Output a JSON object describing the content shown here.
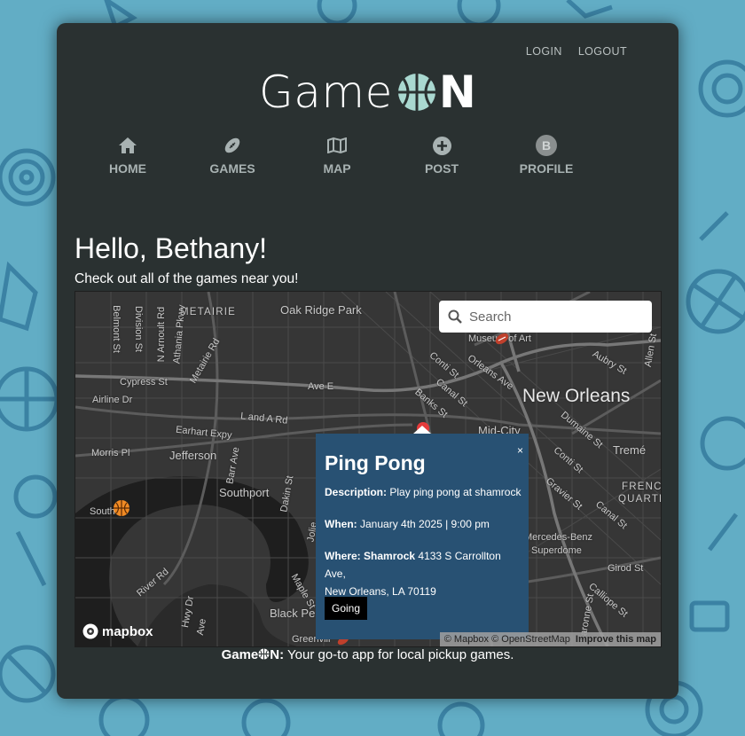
{
  "header": {
    "login_label": "LOGIN",
    "logout_label": "LOGOUT",
    "logo_left": "Game",
    "logo_right": "N"
  },
  "nav": [
    {
      "label": "HOME",
      "icon": "home-icon"
    },
    {
      "label": "GAMES",
      "icon": "football-icon"
    },
    {
      "label": "MAP",
      "icon": "map-icon"
    },
    {
      "label": "POST",
      "icon": "plus-circle-icon"
    },
    {
      "label": "PROFILE",
      "icon": "avatar-b-icon",
      "avatar_letter": "B"
    }
  ],
  "main": {
    "greeting": "Hello, Bethany!",
    "subtitle": "Check out all of the games near you!"
  },
  "map": {
    "search_placeholder": "Search",
    "labels": {
      "metairie": "METAIRIE",
      "oak_ridge_park": "Oak Ridge Park",
      "museum_of_art": "Museum of Art",
      "new_orleans": "New Orleans",
      "mid_city": "Mid-City",
      "treme": "Tremé",
      "french_quarter_a": "FRENCH",
      "french_quarter_b": "QUARTE",
      "jefferson": "Jefferson",
      "southport": "Southport",
      "black_pearl": "Black Pe",
      "greenville": "Greenvill",
      "mercedes_a": "Mercedes-Benz",
      "mercedes_b": "Superdome",
      "airline_dr": "Airline Dr",
      "earhart": "Earhart Expy",
      "cypress": "Cypress St",
      "l_and_a": "L and A Rd",
      "ave_e": "Ave E",
      "conti": "Conti St",
      "orleans_ave": "Orleans Ave",
      "canal": "Canal St",
      "banks": "Banks St",
      "aubry": "Aubry St",
      "allen": "Allen St",
      "dumaine": "Dumaine St",
      "gravier": "Gravier St",
      "girod": "Girod St",
      "calliope": "Calliope St",
      "river_rd": "River Rd",
      "morris": "Morris Pl",
      "south_p": "South P",
      "belmont": "Belmont St",
      "division": "Division St",
      "n_arnoult": "N Arnoult Rd",
      "athania": "Athania Pkwy",
      "metairie_rd": "Metairie Rd",
      "dakin": "Dakin St",
      "maple": "Maple St",
      "jolie": "Jolie",
      "barr": "Barr Ave",
      "conti2": "Conti St",
      "canal2": "Canal St",
      "barrone": "Baronne St",
      "hwy_dr": "Hwy Dr",
      "ave_c": "Ave"
    },
    "popup": {
      "title": "Ping Pong",
      "close": "×",
      "description_label": "Description:",
      "description": "Play ping pong at shamrock",
      "when_label": "When:",
      "when": "January 4th 2025 | 9:00 pm",
      "where_label": "Where:",
      "where_name": "Shamrock",
      "where_address_1": "4133 S Carrollton Ave,",
      "where_address_2": "New Orleans, LA 70119",
      "going_label": "Going"
    },
    "mapbox_logo": "mapbox",
    "attribution": "© Mapbox © OpenStreetMap",
    "improve_label": "Improve this map"
  },
  "footer": {
    "brand_left": "Game",
    "brand_right": "N:",
    "tagline": "Your go-to app for local pickup games."
  }
}
